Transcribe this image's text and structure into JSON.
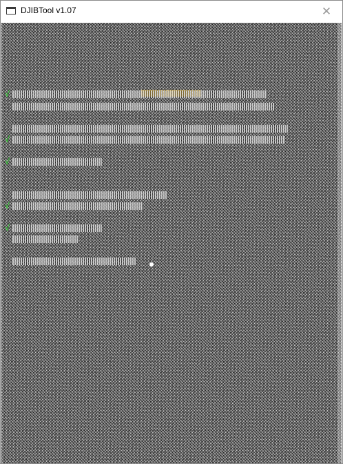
{
  "window": {
    "title": "DJIBTool v1.07",
    "close_symbol": "✕"
  },
  "console": {
    "status_marker": "√"
  }
}
